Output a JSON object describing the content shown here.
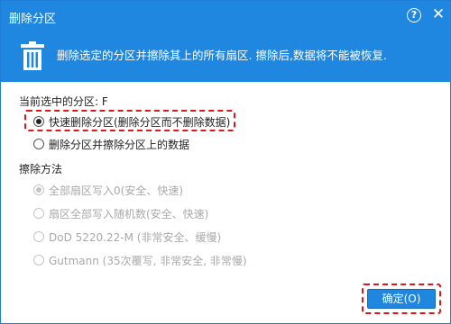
{
  "window": {
    "title": "删除分区",
    "help_label": "?",
    "close_label": "✕"
  },
  "banner": {
    "description": "删除选定的分区并擦除其上的所有扇区. 擦除后,数据将不能被恢复.",
    "icon": "trash-icon"
  },
  "partition": {
    "label": "当前选中的分区: F"
  },
  "delete_options": [
    {
      "label": "快速删除分区(删除分区而不删除数据)",
      "selected": true
    },
    {
      "label": "删除分区并擦除分区上的数据",
      "selected": false
    }
  ],
  "wipe": {
    "label": "擦除方法",
    "methods": [
      {
        "label": "全部扇区写入0(安全、快速)",
        "selected": true,
        "enabled": false
      },
      {
        "label": "扇区全部写入随机数(安全、快速)",
        "selected": false,
        "enabled": false
      },
      {
        "label": "DoD 5220.22-M (非常安全、缓慢)",
        "selected": false,
        "enabled": false
      },
      {
        "label": "Gutmann (35次覆写, 非常安全, 非常慢)",
        "selected": false,
        "enabled": false
      }
    ]
  },
  "footer": {
    "ok_label": "确定(O)"
  },
  "colors": {
    "accent": "#1f87e0",
    "highlight": "#e0141a",
    "disabled_text": "#a9a9a9"
  }
}
